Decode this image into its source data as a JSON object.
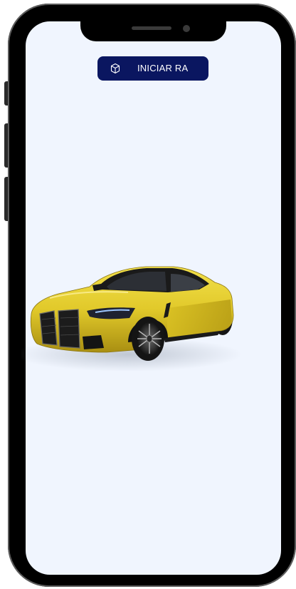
{
  "device": {
    "frame_color": "#000000",
    "screen_background": "#f0f5fe"
  },
  "ar_button": {
    "label": "INICIAR RA",
    "icon": "ar-cube-icon",
    "background": "#0a1660",
    "text_color": "#ffffff"
  },
  "model_viewer": {
    "subject": "car-3d-model",
    "car_color": "#e1c92a"
  }
}
